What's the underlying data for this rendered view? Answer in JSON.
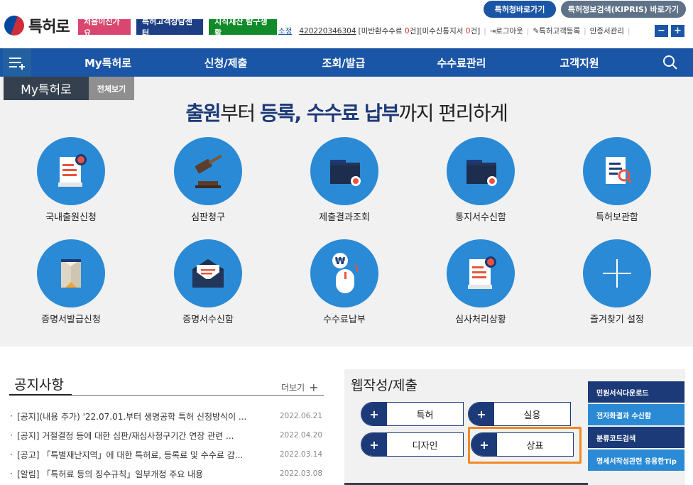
{
  "header": {
    "logo_text": "특허로",
    "pills": [
      "처음이신가요",
      "특허고객상담센터",
      "지식재산 탐구생활"
    ],
    "shortcuts": [
      "특허청바로가기",
      "특허정보검색(KIPRIS) 바로가기"
    ],
    "user": {
      "org": "소정",
      "customer_number": "420220346304",
      "unpaid_prefix": "[미반환수수료 ",
      "unpaid_count": "0",
      "unpaid_suffix": "건]",
      "unreceived_prefix": "[미수신통지서 ",
      "unreceived_count": "0",
      "unreceived_suffix": "건]",
      "logout": "로그아웃",
      "register": "특허고객등록",
      "cert": "인증서관리"
    },
    "zoom_minus": "−",
    "zoom_plus": "+"
  },
  "nav": {
    "items": [
      "My특허로",
      "신청/제출",
      "조회/발급",
      "수수료관리",
      "고객지원"
    ]
  },
  "hero": {
    "my_tab": "My특허로",
    "all_tab": "전체보기",
    "title_parts": [
      "출원",
      "부터 ",
      "등록",
      ", ",
      "수수료 납부",
      "까지 편리하게"
    ],
    "tiles": [
      {
        "label": "국내출원신청",
        "icon": "application-document-icon"
      },
      {
        "label": "심판청구",
        "icon": "gavel-icon"
      },
      {
        "label": "제출결과조회",
        "icon": "folder-badge-icon"
      },
      {
        "label": "통지서수신함",
        "icon": "folder-badge-icon"
      },
      {
        "label": "특허보관함",
        "icon": "document-search-icon"
      },
      {
        "label": "증명서발급신청",
        "icon": "certificate-book-icon"
      },
      {
        "label": "증명서수신함",
        "icon": "envelope-icon"
      },
      {
        "label": "수수료납부",
        "icon": "mouse-won-icon"
      },
      {
        "label": "심사처리상황",
        "icon": "application-document-icon"
      },
      {
        "label": "즐겨찾기 설정",
        "icon": "plus-icon"
      }
    ]
  },
  "notice": {
    "title": "공지사항",
    "more": "더보기",
    "items": [
      {
        "text": "[공지](내용 추가) '22.07.01.부터 생명공학 특허 신청방식이 ...",
        "date": "2022.06.21"
      },
      {
        "text": "[공지] 거절결정 등에 대한 심판/재심사청구기간 연장 관련 ...",
        "date": "2022.04.20"
      },
      {
        "text": "[공고] 「특별재난지역」에 대한 특허료, 등록료 및 수수료 감...",
        "date": "2022.03.14"
      },
      {
        "text": "[알림] 「특허료 등의 징수규칙」일부개정 주요 내용",
        "date": "2022.03.08"
      }
    ]
  },
  "web_submit": {
    "title": "웹작성/제출",
    "buttons": [
      "특허",
      "실용",
      "디자인",
      "상표"
    ],
    "side_links": [
      "민원서식다운로드",
      "전자화결과 수신함",
      "분류코드검색",
      "명세서작성관련 유용한Tip"
    ]
  },
  "colors": {
    "primary": "#1b56a6",
    "navy": "#1c3a78",
    "circle": "#2a8ad5",
    "highlight": "#f08a24"
  }
}
